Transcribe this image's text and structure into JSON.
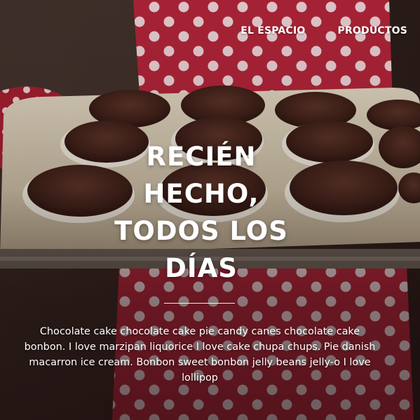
{
  "nav": {
    "items": [
      {
        "label": "EL ESPACIO"
      },
      {
        "label": "PRODUCTOS"
      }
    ]
  },
  "hero": {
    "headline_lines": [
      "RECIÉN",
      "HECHO,",
      "TODOS LOS",
      "DÍAS"
    ],
    "description": "Chocolate cake chocolate cake pie candy canes chocolate cake bonbon. I love marzipan liquorice I love cake chupa chups. Pie danish macarron ice cream. Bonbon sweet bonbon jelly beans jelly-o I love lollipop"
  },
  "colors": {
    "apron_red": "#b5253a",
    "polka_dot": "#f2d8dc",
    "tray": "#d9cdb4",
    "muffin": "#4a2a22",
    "text": "#ffffff"
  },
  "background_image": "baker holding tray of chocolate muffins, red polka-dot apron"
}
